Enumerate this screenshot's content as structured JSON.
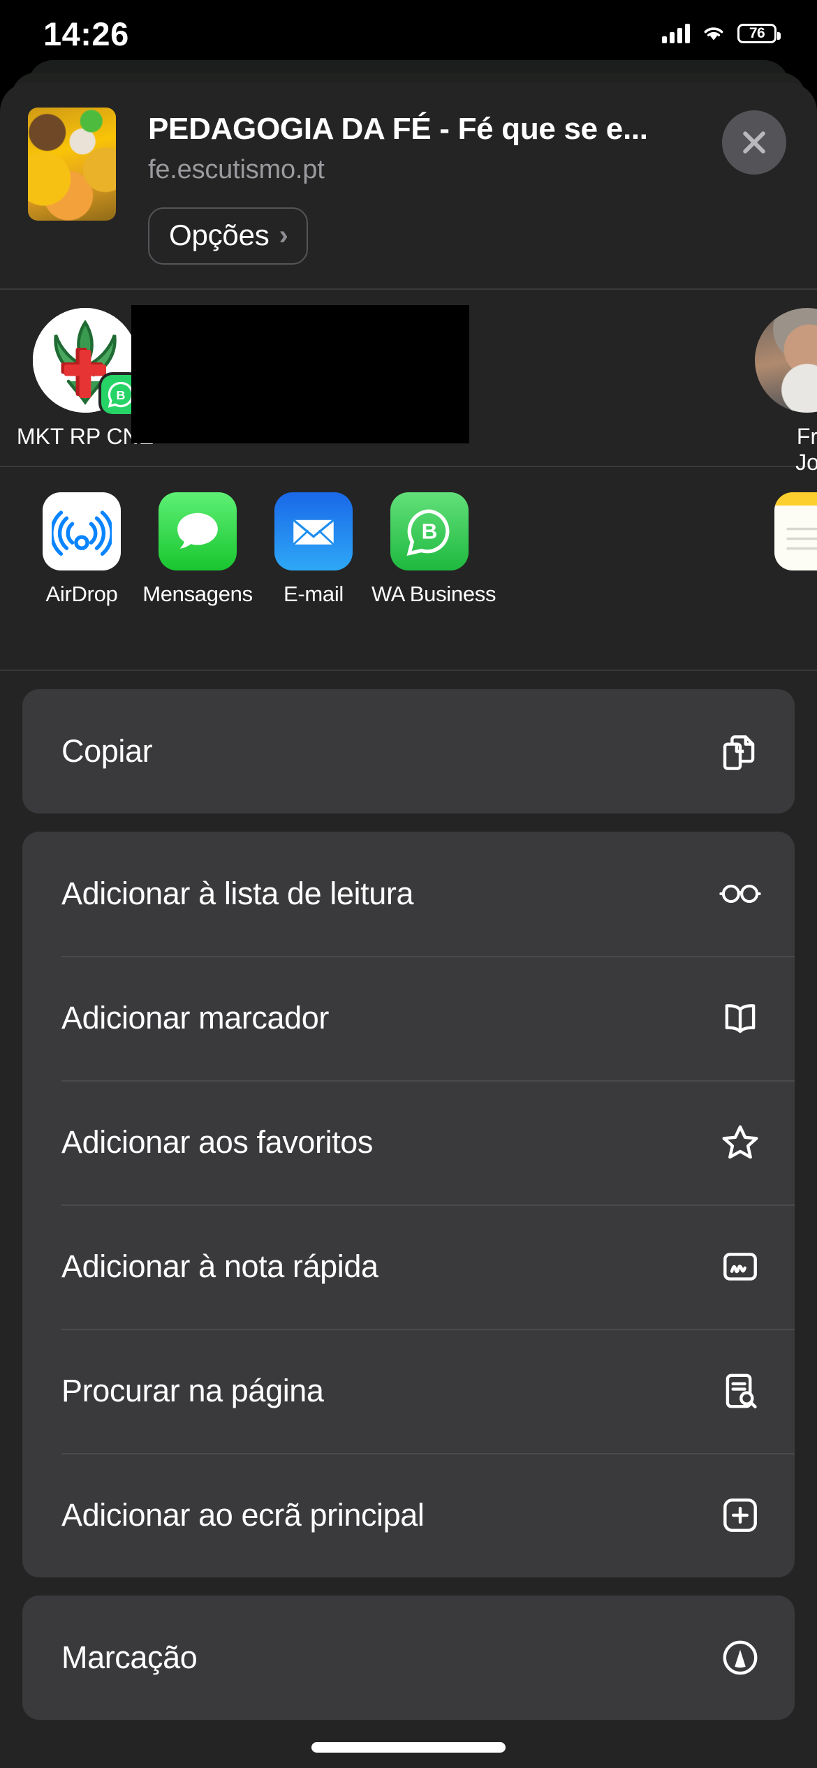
{
  "status_bar": {
    "time": "14:26",
    "battery_percent": "76",
    "signal_icon": "cellular-bars-icon",
    "wifi_icon": "wifi-icon",
    "battery_icon": "battery-icon"
  },
  "share_sheet": {
    "preview": {
      "title": "PEDAGOGIA DA FÉ - Fé que se e...",
      "domain": "fe.escutismo.pt",
      "thumbnail_name": "link-preview-thumbnail",
      "options_label": "Opções",
      "options_chevron": "›",
      "close_icon": "close-icon"
    },
    "contacts": {
      "items": [
        {
          "name": "MKT RP CNE",
          "avatar": "scout-emblem-avatar",
          "badge": "whatsapp-business-badge"
        },
        {
          "name": "Fr\nJo",
          "avatar": "contact-photo-avatar",
          "badge": ""
        }
      ],
      "redaction_name": "redacted-region"
    },
    "apps": {
      "items": [
        {
          "label": "AirDrop",
          "icon": "airdrop-icon"
        },
        {
          "label": "Mensagens",
          "icon": "messages-icon"
        },
        {
          "label": "E-mail",
          "icon": "mail-icon"
        },
        {
          "label": "WA Business",
          "icon": "whatsapp-business-icon"
        },
        {
          "label": "",
          "icon": "notes-icon"
        }
      ]
    },
    "action_groups": [
      {
        "rows": [
          {
            "label": "Copiar",
            "icon": "copy-icon"
          }
        ]
      },
      {
        "rows": [
          {
            "label": "Adicionar à lista de leitura",
            "icon": "glasses-icon"
          },
          {
            "label": "Adicionar marcador",
            "icon": "book-icon"
          },
          {
            "label": "Adicionar aos favoritos",
            "icon": "star-icon"
          },
          {
            "label": "Adicionar à nota rápida",
            "icon": "quick-note-icon"
          },
          {
            "label": "Procurar na página",
            "icon": "find-in-page-icon"
          },
          {
            "label": "Adicionar ao ecrã principal",
            "icon": "add-to-home-icon"
          }
        ]
      },
      {
        "rows": [
          {
            "label": "Marcação",
            "icon": "markup-icon"
          }
        ]
      }
    ]
  },
  "colors": {
    "sheet_bg": "#242424",
    "card_bg": "#3a3a3c",
    "accent_green": "#25d366",
    "mail_blue": "#2ea8f7",
    "text_primary": "#ffffff",
    "text_secondary": "#9b9b9f"
  }
}
